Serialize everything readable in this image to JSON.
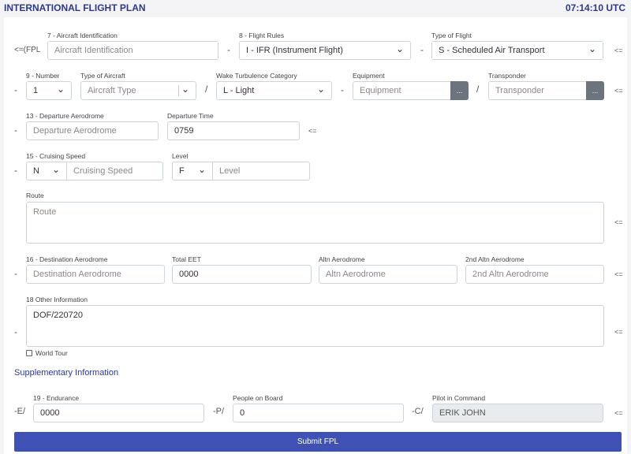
{
  "header": {
    "title": "INTERNATIONAL FLIGHT PLAN",
    "clock": "07:14:10 UTC"
  },
  "row1": {
    "prefix": "<=(FPL",
    "aircraft_id": {
      "label": "7 - Aircraft Identification",
      "placeholder": "Aircraft Identification"
    },
    "dash1": "-",
    "flight_rules": {
      "label": "8 - Flight Rules",
      "value": "I - IFR (Instrument Flight)"
    },
    "dash2": "-",
    "type_of_flight": {
      "label": "Type of Flight",
      "value": "S - Scheduled Air Transport"
    },
    "end": "<="
  },
  "row2": {
    "dash": "-",
    "number": {
      "label": "9 - Number",
      "value": "1"
    },
    "aircraft_type": {
      "label": "Type of Aircraft",
      "placeholder": "Aircraft Type"
    },
    "slash1": "/",
    "wake": {
      "label": "Wake Turbulence Category",
      "value": "L - Light"
    },
    "dash2": "-",
    "equipment": {
      "label": "Equipment",
      "placeholder": "Equipment",
      "button": "..."
    },
    "slash2": "/",
    "transponder": {
      "label": "Transponder",
      "placeholder": "Transponder",
      "button": "..."
    },
    "end": "<="
  },
  "row3": {
    "dash": "-",
    "departure": {
      "label": "13 - Departure Aerodrome",
      "placeholder": "Departure Aerodrome"
    },
    "dep_time": {
      "label": "Departure Time",
      "value": "0759"
    },
    "end": "<="
  },
  "row4": {
    "dash": "-",
    "speed": {
      "label": "15 - Cruising Speed",
      "unit": "N",
      "placeholder": "Cruising Speed"
    },
    "level": {
      "label": "Level",
      "unit": "F",
      "placeholder": "Level"
    }
  },
  "route": {
    "label": "Route",
    "placeholder": "Route",
    "end": "<="
  },
  "row6": {
    "dash": "-",
    "dest": {
      "label": "16 - Destination Aerodrome",
      "placeholder": "Destination Aerodrome"
    },
    "eet": {
      "label": "Total EET",
      "value": "0000"
    },
    "altn": {
      "label": "Altn Aerodrome",
      "placeholder": "Altn Aerodrome"
    },
    "altn2": {
      "label": "2nd Altn Aerodrome",
      "placeholder": "2nd Altn Aerodrome"
    },
    "end": "<="
  },
  "other": {
    "dash": "-",
    "label": "18 Other Information",
    "value": "DOF/220720",
    "end": "<=",
    "world_tour": "World Tour",
    "world_tour_checked": false
  },
  "supplementary": {
    "heading": "Supplementary Information",
    "e_prefix": "-E/",
    "endurance": {
      "label": "19 - Endurance",
      "value": "0000"
    },
    "p_prefix": "-P/",
    "people": {
      "label": "People on Board",
      "value": "0"
    },
    "c_prefix": "-C/",
    "pilot": {
      "label": "Pilot in Command",
      "value": "ERIK JOHN"
    },
    "end": "<="
  },
  "submit": "Submit FPL",
  "colors": {
    "accent": "#3f51b5",
    "title": "#2b3990"
  }
}
